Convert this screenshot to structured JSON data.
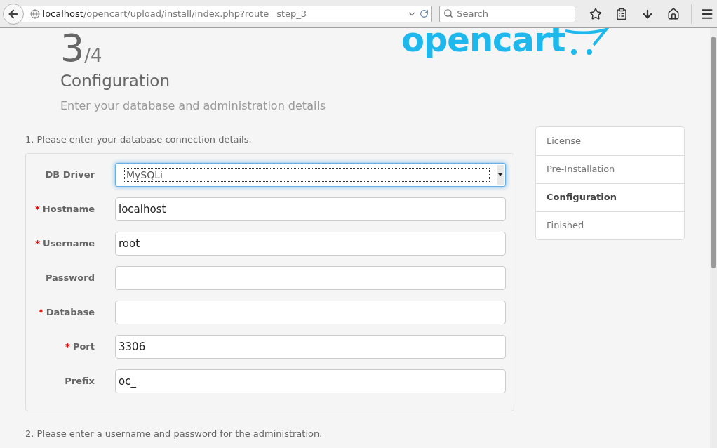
{
  "browser": {
    "url_host": "localhost",
    "url_path": "/opencart/upload/install/index.php?route=step_3",
    "search": {
      "placeholder": "Search"
    }
  },
  "header": {
    "step": "3",
    "total": "/4",
    "title": "Configuration",
    "subtitle": "Enter your database and administration details",
    "logo": "opencart"
  },
  "database_section": {
    "heading": "1. Please enter your database connection details.",
    "required_mark": "*",
    "fields": [
      {
        "kind": "select",
        "label": "DB Driver",
        "required": false,
        "value": "MySQLi"
      },
      {
        "kind": "text",
        "label": "Hostname",
        "required": true,
        "value": "localhost"
      },
      {
        "kind": "text",
        "label": "Username",
        "required": true,
        "value": "root"
      },
      {
        "kind": "text",
        "label": "Password",
        "required": false
      },
      {
        "kind": "text",
        "label": "Database",
        "required": true
      },
      {
        "kind": "text",
        "label": "Port",
        "required": true,
        "value": "3306"
      },
      {
        "kind": "text",
        "label": "Prefix",
        "required": false,
        "value": "oc_"
      }
    ]
  },
  "admin_section": {
    "heading": "2. Please enter a username and password for the administration."
  },
  "steps": [
    {
      "label": "License",
      "selected": false
    },
    {
      "label": "Pre-Installation",
      "selected": false
    },
    {
      "label": "Configuration",
      "selected": true
    },
    {
      "label": "Finished",
      "selected": false
    }
  ]
}
